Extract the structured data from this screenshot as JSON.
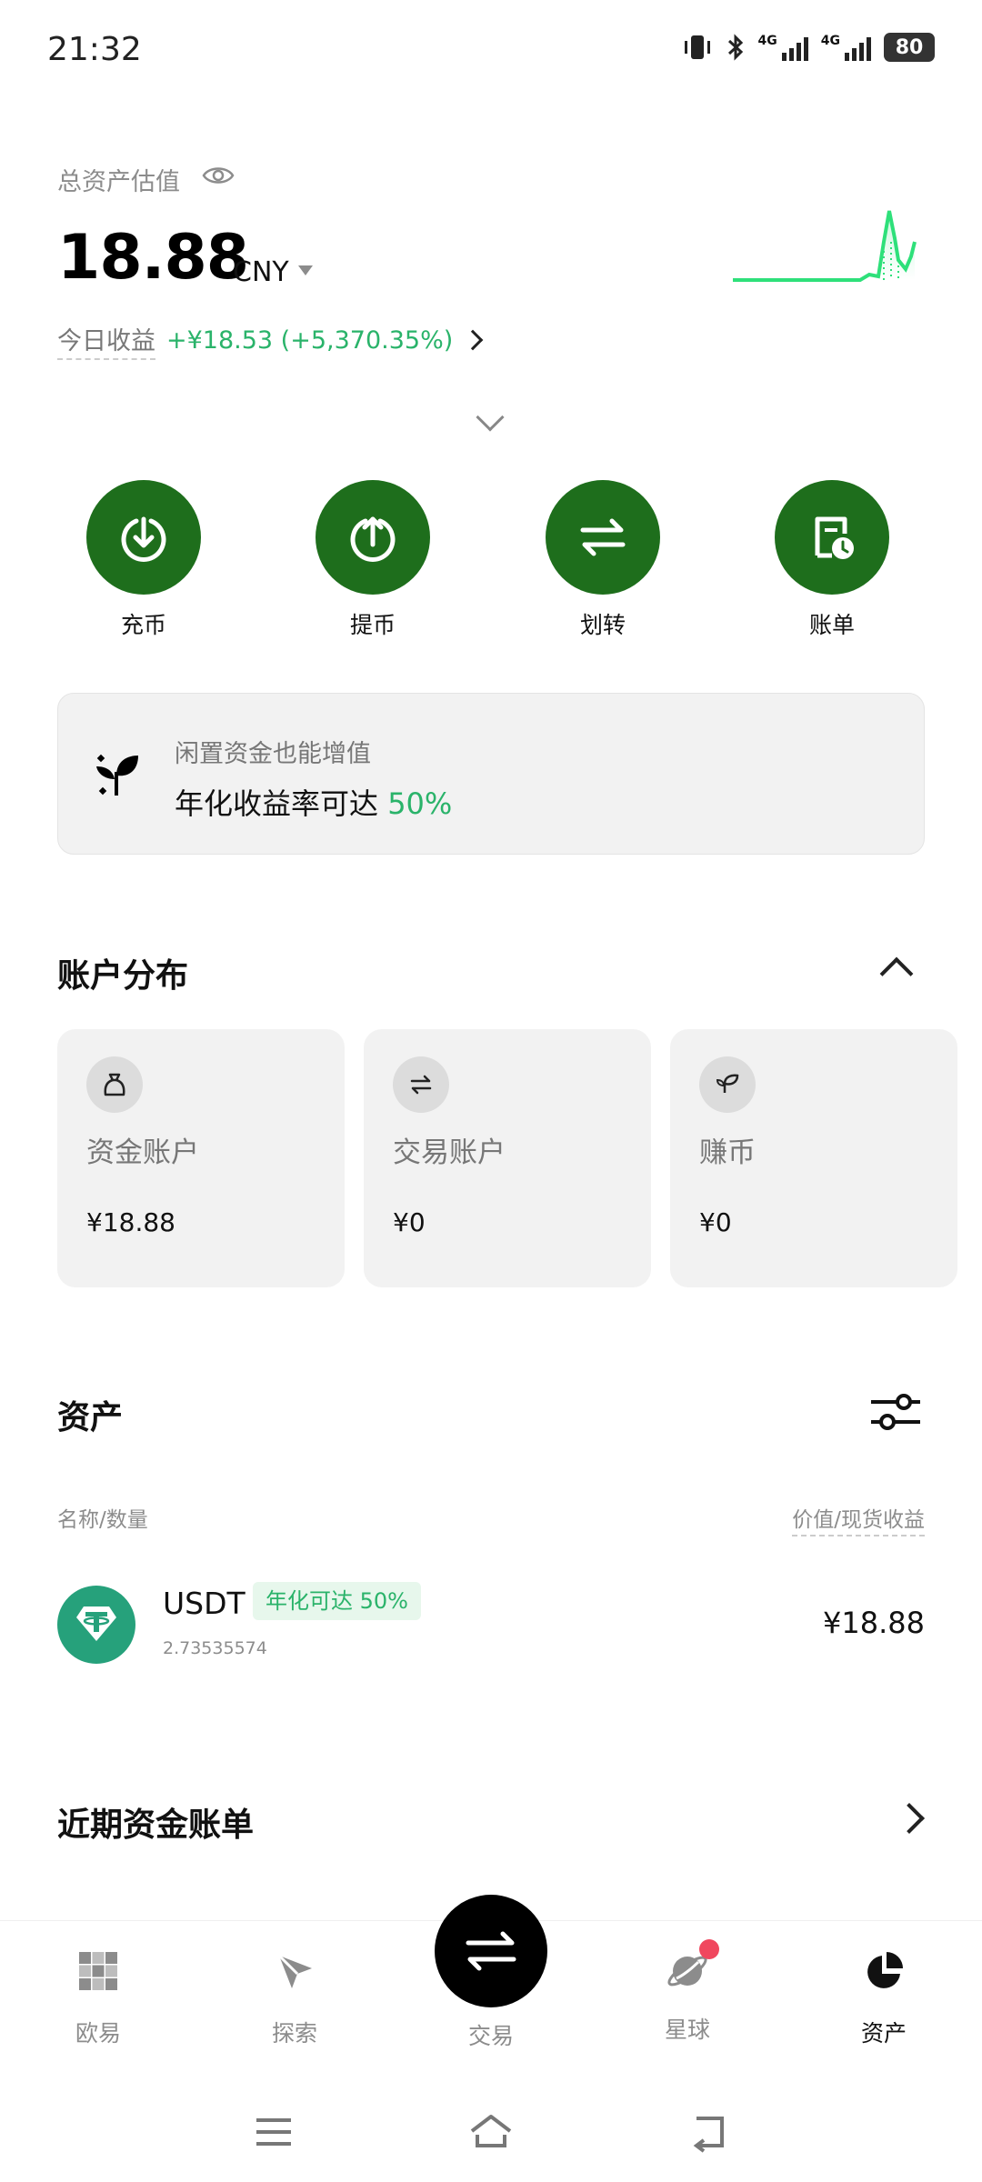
{
  "status_bar": {
    "time": "21:32",
    "net1": "4G",
    "net2": "4G",
    "battery": "80"
  },
  "header": {
    "total_label": "总资产估值",
    "total_value": "18.88",
    "currency": "CNY",
    "today_label": "今日收益",
    "today_value": "+¥18.53 (+5,370.35%)"
  },
  "actions": [
    {
      "label": "充币",
      "icon": "deposit-icon"
    },
    {
      "label": "提币",
      "icon": "withdraw-icon"
    },
    {
      "label": "划转",
      "icon": "transfer-icon"
    },
    {
      "label": "账单",
      "icon": "bill-icon"
    }
  ],
  "earn_banner": {
    "line1": "闲置资金也能增值",
    "line2_prefix": "年化收益率可达",
    "line2_highlight": "50%"
  },
  "account_distribution": {
    "title": "账户分布",
    "accounts": [
      {
        "name": "资金账户",
        "value": "¥18.88",
        "icon": "money-bag-icon"
      },
      {
        "name": "交易账户",
        "value": "¥0",
        "icon": "swap-icon"
      },
      {
        "name": "赚币",
        "value": "¥0",
        "icon": "earn-icon"
      }
    ]
  },
  "assets": {
    "title": "资产",
    "col_left": "名称/数量",
    "col_right": "价值/现货收益",
    "rows": [
      {
        "name": "USDT",
        "badge": "年化可达 50%",
        "quantity": "2.73535574",
        "value": "¥18.88",
        "icon": "tether-icon"
      }
    ]
  },
  "recent_bills": {
    "title": "近期资金账单"
  },
  "bottom_nav": {
    "items": [
      {
        "label": "欧易",
        "icon": "okx-logo-icon"
      },
      {
        "label": "探索",
        "icon": "compass-icon"
      },
      {
        "label": "交易",
        "icon": "trade-swap-icon"
      },
      {
        "label": "星球",
        "icon": "planet-icon"
      },
      {
        "label": "资产",
        "icon": "pie-chart-icon"
      }
    ]
  },
  "colors": {
    "brand_green": "#1e6e1c",
    "profit_green": "#2ab36a",
    "notification_red": "#f0475e"
  }
}
